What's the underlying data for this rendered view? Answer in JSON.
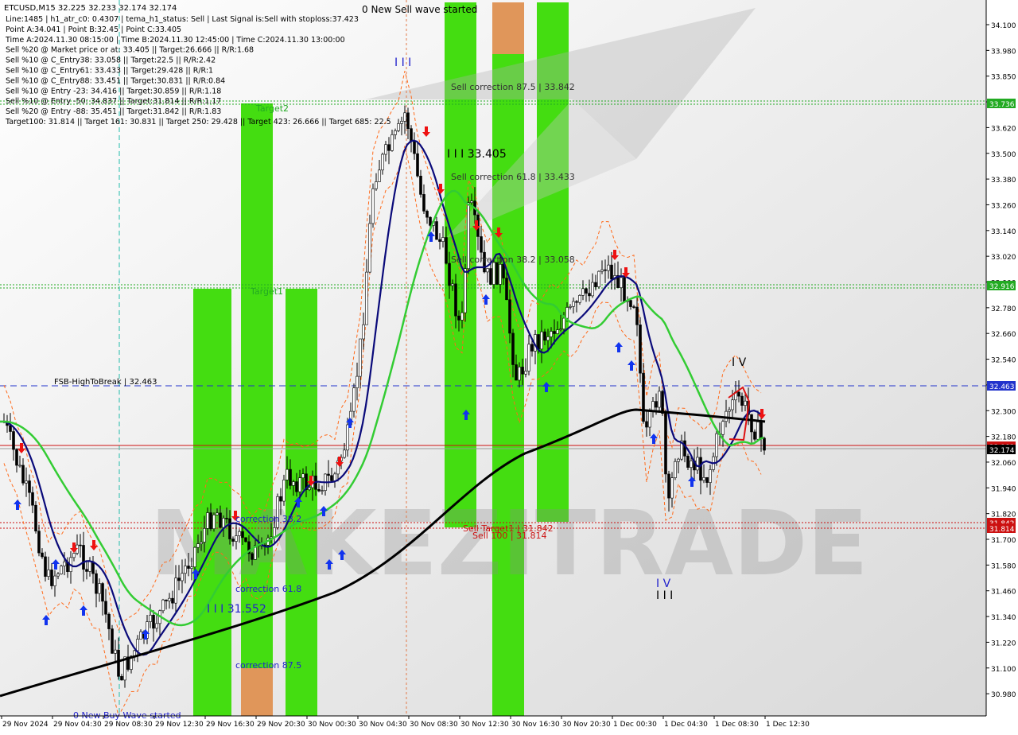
{
  "header": {
    "symbol_line": "ETCUSD,M15  32.225 32.233 32.174 32.174",
    "info_lines": [
      "Line:1485 | h1_atr_c0: 0.4307 | tema_h1_status: Sell | Last Signal is:Sell with stoploss:37.423",
      "Point A:34.041 | Point B:32.45 | Point C:33.405",
      "Time A:2024.11.30 08:15:00 | Time B:2024.11.30 12:45:00 | Time C:2024.11.30 13:00:00",
      "Sell %20 @ Market price or at: 33.405 || Target:26.666 || R/R:1.68",
      "Sell %10 @ C_Entry38: 33.058 || Target:22.5 || R/R:2.42",
      "Sell %10 @ C_Entry61: 33.433 || Target:29.428 || R/R:1",
      "Sell %10 @ C_Entry88: 33.451 || Target:30.831 || R/R:0.84",
      "Sell %10 @ Entry -23: 34.416 || Target:30.859 || R/R:1.18",
      "Sell %10 @ Entry -50: 34.837 || Target:31.814 || R/R:1.17",
      "Sell %20 @ Entry -88: 35.451 || Target:31.842 || R/R:1.83",
      "Target100: 31.814 || Target 161: 30.831 || Target 250: 29.428 || Target 423: 26.666 || Target 685: 22.5"
    ]
  },
  "annotations": {
    "new_sell_wave": "0 New Sell wave started",
    "new_buy_wave": "0 New Buy Wave started",
    "wave_iii_top": "I I I",
    "wave_iii_price": "I I I 33.405",
    "wave_iii_low": "I I I 31.552",
    "wave_iv_right": "I V",
    "wave_iv_bottom": "I V",
    "wave_iii_bottom": "I I I",
    "sell_corr_875": "Sell correction 87.5 | 33.842",
    "sell_corr_618": "Sell correction 61.8 | 33.433",
    "sell_corr_382": "Sell correction 38.2 | 33.058",
    "correction_382": "correction 38.2",
    "correction_618": "correction 61.8",
    "correction_875": "correction 87.5",
    "target2": "Target2",
    "target1": "Target1",
    "fsb": "FSB-HighToBreak | 32.463",
    "sell_target1": "Sell Target1 | 31.842",
    "sell_100": "Sell 100 | 31.814",
    "watermark": "MAKEZITRADE"
  },
  "price_axis": {
    "ticks": [
      "34.100",
      "33.980",
      "33.850",
      "33.740",
      "33.620",
      "33.500",
      "33.380",
      "33.260",
      "33.140",
      "33.020",
      "32.900",
      "32.780",
      "32.660",
      "32.540",
      "32.420",
      "32.300",
      "32.180",
      "32.060",
      "31.940",
      "31.820",
      "31.700",
      "31.580",
      "31.460",
      "31.340",
      "31.220",
      "31.100",
      "30.980"
    ],
    "labels": [
      {
        "text": "33.736",
        "color": "#22aa22"
      },
      {
        "text": "32.916",
        "color": "#22aa22"
      },
      {
        "text": "32.463",
        "color": "#2233cc"
      },
      {
        "text": "32.183",
        "color": "#cc1111"
      },
      {
        "text": "32.174",
        "color": "#000000"
      },
      {
        "text": "31.842",
        "color": "#cc1111"
      },
      {
        "text": "31.814",
        "color": "#cc1111"
      }
    ]
  },
  "time_axis": [
    "29 Nov 2024",
    "29 Nov 04:30",
    "29 Nov 08:30",
    "29 Nov 12:30",
    "29 Nov 16:30",
    "29 Nov 20:30",
    "30 Nov 00:30",
    "30 Nov 04:30",
    "30 Nov 08:30",
    "30 Nov 12:30",
    "30 Nov 16:30",
    "30 Nov 20:30",
    "1 Dec 00:30",
    "1 Dec 04:30",
    "1 Dec 08:30",
    "1 Dec 12:30"
  ],
  "colors": {
    "up_candle": "#ffffff",
    "down_candle": "#000000",
    "ma_blue": "#0a0a7a",
    "ma_green": "#33cc33",
    "ma_black": "#000000",
    "zone_green": "#44dd11",
    "zone_orange": "#e0965a",
    "fsb_line": "#2233cc",
    "red_line": "#cc1111",
    "green_dotted": "#22aa22"
  }
}
